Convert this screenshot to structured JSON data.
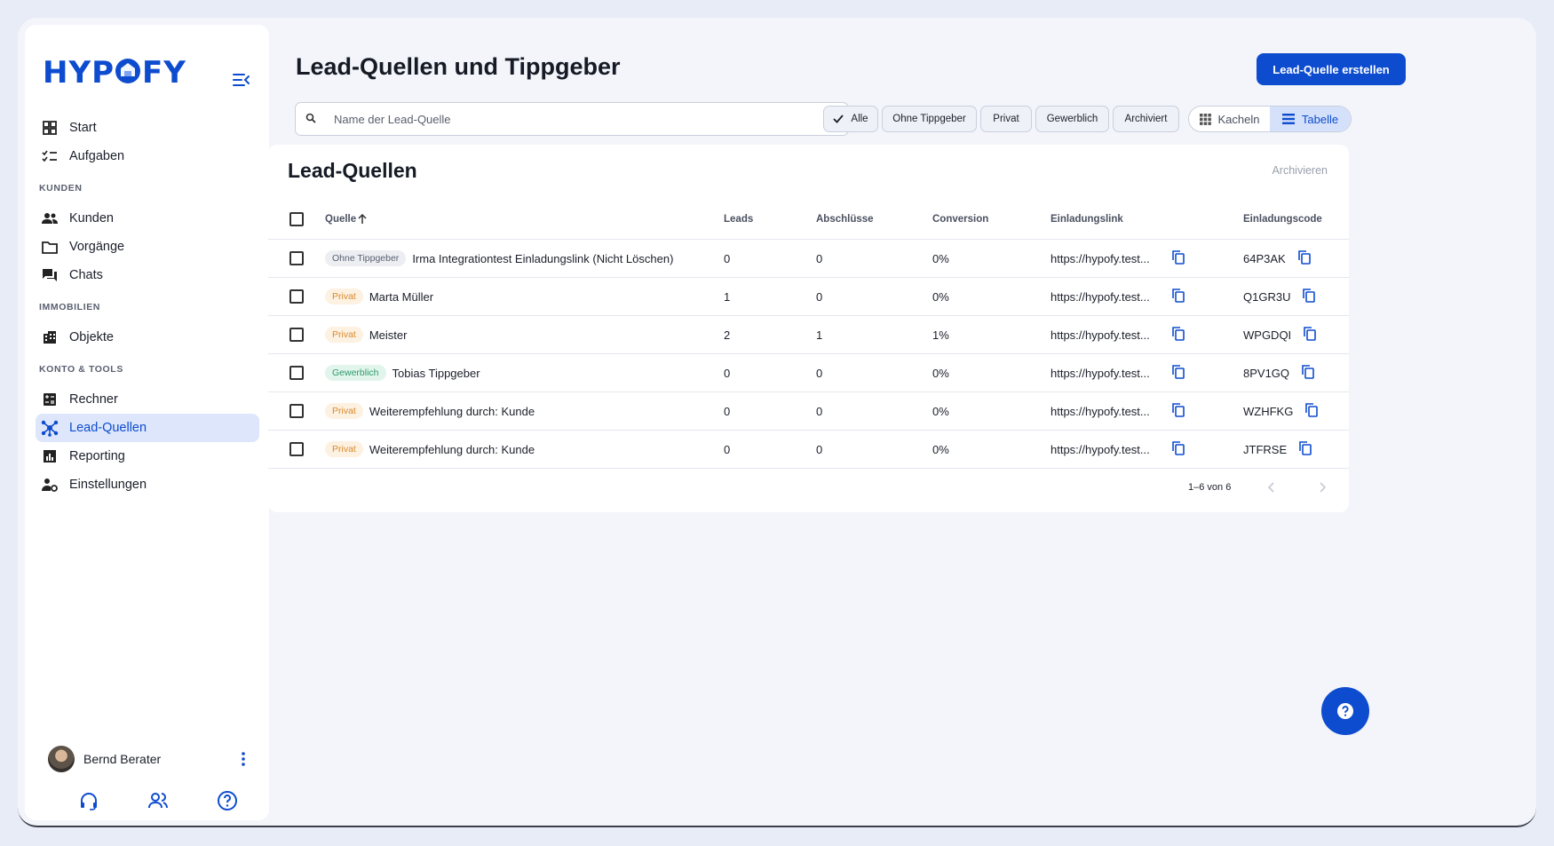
{
  "brand": {
    "name": "HYPOFY",
    "accent": "#0e4ccf"
  },
  "sidebar": {
    "collapse_icon": "menu-collapse-icon",
    "items_top": [
      {
        "label": "Start",
        "icon": "grid-icon"
      },
      {
        "label": "Aufgaben",
        "icon": "checklist-icon"
      }
    ],
    "section_kunden": "KUNDEN",
    "items_kunden": [
      {
        "label": "Kunden",
        "icon": "people-icon"
      },
      {
        "label": "Vorgänge",
        "icon": "folder-icon"
      },
      {
        "label": "Chats",
        "icon": "chat-icon"
      }
    ],
    "section_immobilien": "IMMOBILIEN",
    "items_immobilien": [
      {
        "label": "Objekte",
        "icon": "building-icon"
      }
    ],
    "section_tools": "KONTO & TOOLS",
    "items_tools": [
      {
        "label": "Rechner",
        "icon": "calculator-icon"
      },
      {
        "label": "Lead-Quellen",
        "icon": "hub-icon",
        "active": true
      },
      {
        "label": "Reporting",
        "icon": "chart-icon"
      },
      {
        "label": "Einstellungen",
        "icon": "user-settings-icon"
      }
    ],
    "user": {
      "name": "Bernd Berater"
    }
  },
  "header": {
    "title": "Lead-Quellen und Tippgeber",
    "create_button": "Lead-Quelle erstellen"
  },
  "filters": {
    "search_placeholder": "Name der Lead-Quelle",
    "search_value": "",
    "chips": [
      "Alle",
      "Ohne Tippgeber",
      "Privat",
      "Gewerblich",
      "Archiviert"
    ],
    "active_chip": "Alle",
    "view_toggle": [
      "Kacheln",
      "Tabelle"
    ],
    "active_view": "Tabelle"
  },
  "card": {
    "title": "Lead-Quellen",
    "archive_label": "Archivieren",
    "columns": {
      "source": "Quelle",
      "leads": "Leads",
      "closings": "Abschlüsse",
      "conversion": "Conversion",
      "invite_link": "Einladungslink",
      "invite_code": "Einladungscode"
    },
    "rows": [
      {
        "tag": "Ohne Tippgeber",
        "tag_type": "none",
        "name": "Irma Integrationtest Einladungslink (Nicht Löschen)",
        "leads": "0",
        "closings": "0",
        "conversion": "0%",
        "link": "https://hypofy.test...",
        "code": "64P3AK"
      },
      {
        "tag": "Privat",
        "tag_type": "privat",
        "name": "Marta Müller",
        "leads": "1",
        "closings": "0",
        "conversion": "0%",
        "link": "https://hypofy.test...",
        "code": "Q1GR3U"
      },
      {
        "tag": "Privat",
        "tag_type": "privat",
        "name": "Meister",
        "leads": "2",
        "closings": "1",
        "conversion": "1%",
        "link": "https://hypofy.test...",
        "code": "WPGDQI"
      },
      {
        "tag": "Gewerblich",
        "tag_type": "gewerb",
        "name": "Tobias Tippgeber",
        "leads": "0",
        "closings": "0",
        "conversion": "0%",
        "link": "https://hypofy.test...",
        "code": "8PV1GQ"
      },
      {
        "tag": "Privat",
        "tag_type": "privat",
        "name": "Weiterempfehlung durch: Kunde",
        "leads": "0",
        "closings": "0",
        "conversion": "0%",
        "link": "https://hypofy.test...",
        "code": "WZHFKG"
      },
      {
        "tag": "Privat",
        "tag_type": "privat",
        "name": "Weiterempfehlung durch: Kunde",
        "leads": "0",
        "closings": "0",
        "conversion": "0%",
        "link": "https://hypofy.test...",
        "code": "JTFRSE"
      }
    ],
    "pagination": "1–6 von 6"
  },
  "help_icon": "help-question-icon"
}
